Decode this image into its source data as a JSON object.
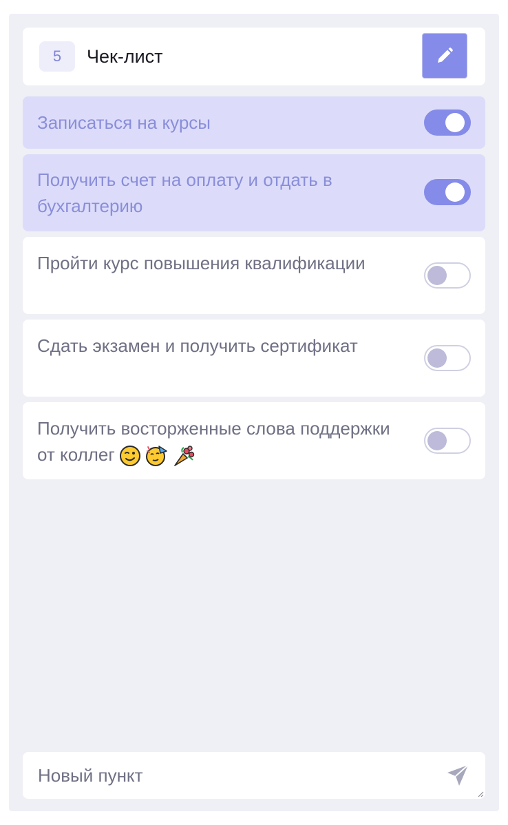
{
  "header": {
    "count": "5",
    "title": "Чек-лист",
    "edit_icon": "pencil-icon"
  },
  "items": [
    {
      "text": "Записаться на курсы",
      "checked": true
    },
    {
      "text": "Получить счет на оплату и отдать в бухгалтерию",
      "checked": true
    },
    {
      "text": "Пройти курс повышения квалификации",
      "checked": false
    },
    {
      "text": "Сдать экзамен и получить сертификат",
      "checked": false
    },
    {
      "text": "Получить восторженные слова поддержки от коллег",
      "checked": false,
      "emojis": [
        "winking-face",
        "partying-face",
        "bouquet"
      ]
    }
  ],
  "new_item": {
    "placeholder": "Новый пункт",
    "send_icon": "paper-plane-icon"
  },
  "colors": {
    "accent": "#858be8",
    "done_background": "#dcdcfa",
    "panel_background": "#efeff6"
  }
}
